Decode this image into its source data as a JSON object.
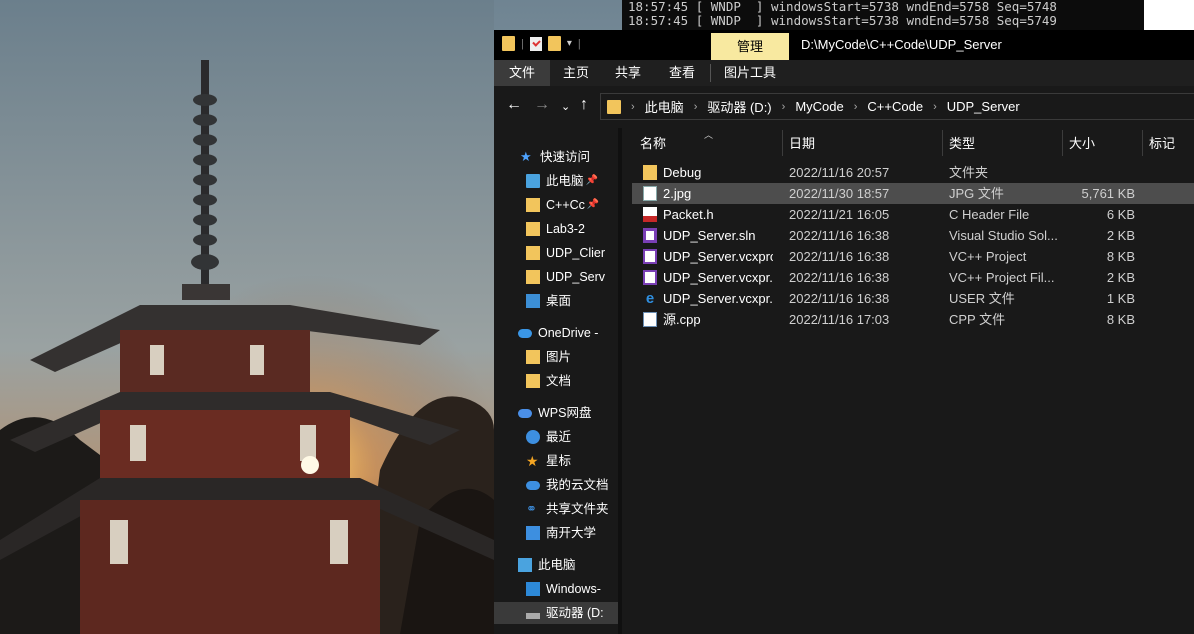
{
  "console": {
    "lines": [
      "18:57:45 [ WNDP  ] windowsStart=5738 wndEnd=5758 Seq=5748",
      "18:57:45 [ WNDP  ] windowsStart=5738 wndEnd=5758 Seq=5749"
    ]
  },
  "explorer": {
    "title_path": "D:\\MyCode\\C++Code\\UDP_Server",
    "manage_tab": "管理",
    "ribbon_tabs": [
      "文件",
      "主页",
      "共享",
      "查看",
      "图片工具"
    ],
    "breadcrumb": [
      "此电脑",
      "驱动器 (D:)",
      "MyCode",
      "C++Code",
      "UDP_Server"
    ],
    "nav_items": [
      {
        "label": "快速访问",
        "icon": "star-icon"
      },
      {
        "label": "此电脑",
        "icon": "pc-icon",
        "pinned": true
      },
      {
        "label": "C++Cc",
        "icon": "folder-icon",
        "pinned": true
      },
      {
        "label": "Lab3-2",
        "icon": "folder-icon"
      },
      {
        "label": "UDP_Clier",
        "icon": "folder-icon"
      },
      {
        "label": "UDP_Serv",
        "icon": "folder-icon"
      },
      {
        "label": "桌面",
        "icon": "desktop-icon"
      },
      {
        "label": "OneDrive -",
        "icon": "cloud-icon"
      },
      {
        "label": "图片",
        "icon": "folder-icon"
      },
      {
        "label": "文档",
        "icon": "folder-icon"
      },
      {
        "label": "WPS网盘",
        "icon": "cloud-icon"
      },
      {
        "label": "最近",
        "icon": "clock-icon"
      },
      {
        "label": "星标",
        "icon": "star-icon"
      },
      {
        "label": "我的云文档",
        "icon": "cloud-icon"
      },
      {
        "label": "共享文件夹",
        "icon": "share-icon"
      },
      {
        "label": "南开大学",
        "icon": "org-icon"
      },
      {
        "label": "此电脑",
        "icon": "pc-icon"
      },
      {
        "label": "Windows-",
        "icon": "drive-icon"
      },
      {
        "label": "驱动器 (D:",
        "icon": "drive-icon"
      }
    ],
    "columns": {
      "name": "名称",
      "date": "日期",
      "type": "类型",
      "size": "大小",
      "tags": "标记"
    },
    "files": [
      {
        "name": "Debug",
        "date": "2022/11/16 20:57",
        "type": "文件夹",
        "size": "",
        "icon": "folder-icon"
      },
      {
        "name": "2.jpg",
        "date": "2022/11/30 18:57",
        "type": "JPG 文件",
        "size": "5,761 KB",
        "icon": "image-file-icon",
        "selected": true
      },
      {
        "name": "Packet.h",
        "date": "2022/11/21 16:05",
        "type": "C Header File",
        "size": "6 KB",
        "icon": "header-file-icon"
      },
      {
        "name": "UDP_Server.sln",
        "date": "2022/11/16 16:38",
        "type": "Visual Studio Sol...",
        "size": "2 KB",
        "icon": "sln-file-icon"
      },
      {
        "name": "UDP_Server.vcxproj",
        "date": "2022/11/16 16:38",
        "type": "VC++ Project",
        "size": "8 KB",
        "icon": "vcxproj-file-icon"
      },
      {
        "name": "UDP_Server.vcxpr...",
        "date": "2022/11/16 16:38",
        "type": "VC++ Project Fil...",
        "size": "2 KB",
        "icon": "filters-file-icon"
      },
      {
        "name": "UDP_Server.vcxpr...",
        "date": "2022/11/16 16:38",
        "type": "USER 文件",
        "size": "1 KB",
        "icon": "user-file-icon"
      },
      {
        "name": "源.cpp",
        "date": "2022/11/16 17:03",
        "type": "CPP 文件",
        "size": "8 KB",
        "icon": "cpp-file-icon"
      }
    ]
  }
}
